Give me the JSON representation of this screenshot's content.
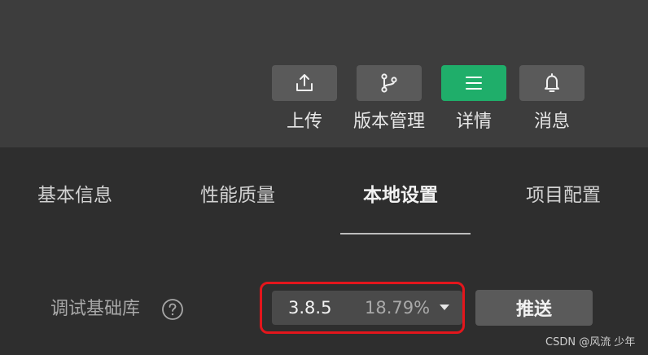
{
  "toolbar": {
    "upload": {
      "label": "上传",
      "icon": "upload-icon"
    },
    "version_control": {
      "label": "版本管理",
      "icon": "branch-icon"
    },
    "details": {
      "label": "详情",
      "icon": "menu-icon",
      "active": true
    },
    "messages": {
      "label": "消息",
      "icon": "bell-icon"
    }
  },
  "tabs": [
    {
      "label": "基本信息"
    },
    {
      "label": "性能质量"
    },
    {
      "label": "本地设置",
      "active": true
    },
    {
      "label": "项目配置"
    }
  ],
  "setting": {
    "label": "调试基础库",
    "version": "3.8.5",
    "percent": "18.79%",
    "push_label": "推送"
  },
  "colors": {
    "accent": "#1fae6a",
    "highlight": "#e3161c"
  },
  "watermark": "CSDN @风流 少年"
}
